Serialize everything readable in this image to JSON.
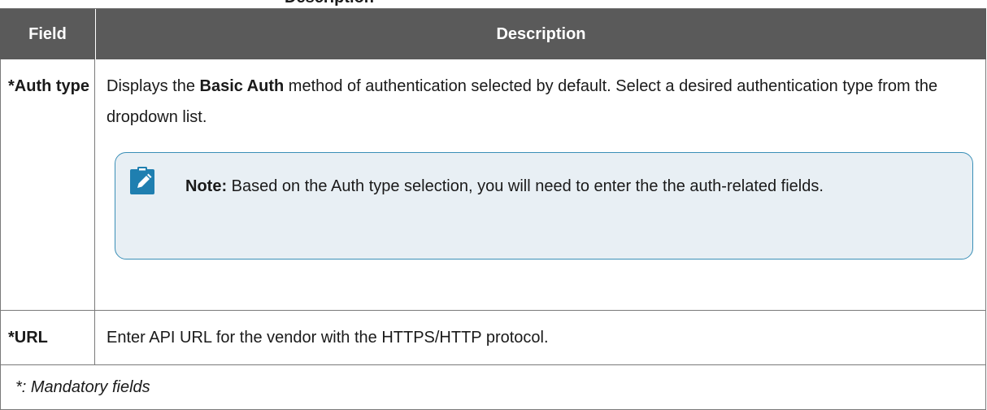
{
  "caption": "Description",
  "table": {
    "headers": {
      "field": "Field",
      "description": "Description"
    },
    "rows": [
      {
        "field": "*Auth type",
        "desc_before": "Displays the ",
        "desc_bold": "Basic Auth",
        "desc_after": " method of authentication selected by default. Select a desired authentication type from the dropdown list.",
        "note": {
          "label": "Note:",
          "text": " Based on the Auth type selection, you will need to enter the the auth-related fields.",
          "icon": "pencil-note-icon"
        }
      },
      {
        "field": "*URL",
        "description": "Enter API URL for the vendor with the HTTPS/HTTP protocol."
      }
    ],
    "footer": "*: Mandatory fields"
  },
  "colors": {
    "header_bg": "#5a5a5a",
    "note_border": "#3a8fb7",
    "note_bg": "#e8eff4",
    "note_icon": "#1f7fb0"
  }
}
